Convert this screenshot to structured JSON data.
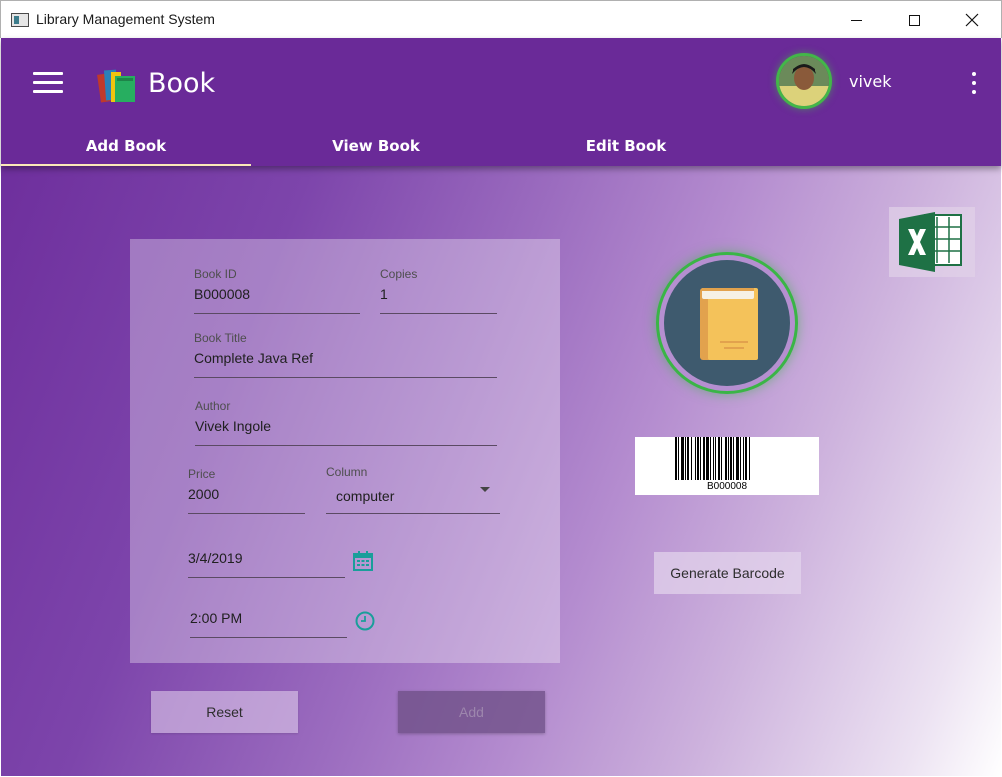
{
  "window": {
    "title": "Library Management System"
  },
  "header": {
    "title": "Book",
    "username": "vivek"
  },
  "tabs": [
    {
      "label": "Add Book",
      "active": true
    },
    {
      "label": "View Book",
      "active": false
    },
    {
      "label": "Edit Book",
      "active": false
    }
  ],
  "form": {
    "book_id": {
      "label": "Book ID",
      "value": "B000008"
    },
    "copies": {
      "label": "Copies",
      "value": "1"
    },
    "book_title": {
      "label": "Book Title",
      "value": "Complete Java Ref"
    },
    "author": {
      "label": "Author",
      "value": "Vivek Ingole"
    },
    "price": {
      "label": "Price",
      "value": "2000"
    },
    "column": {
      "label": "Column",
      "value": "computer"
    },
    "date": {
      "value": "3/4/2019"
    },
    "time": {
      "value": "2:00 PM"
    }
  },
  "buttons": {
    "reset": "Reset",
    "add": "Add",
    "generate_barcode": "Generate Barcode"
  },
  "barcode": {
    "text": "B000008"
  },
  "icons": {
    "menu": "hamburger-icon",
    "logo": "books-icon",
    "more": "kebab-icon",
    "calendar": "calendar-icon",
    "clock": "clock-icon",
    "excel": "excel-icon",
    "book": "book-icon"
  },
  "colors": {
    "appbar": "#6a2a98",
    "accent_green": "#43b649",
    "tab_indicator": "#fbe9b8",
    "teal_icon": "#1a9e9a"
  }
}
